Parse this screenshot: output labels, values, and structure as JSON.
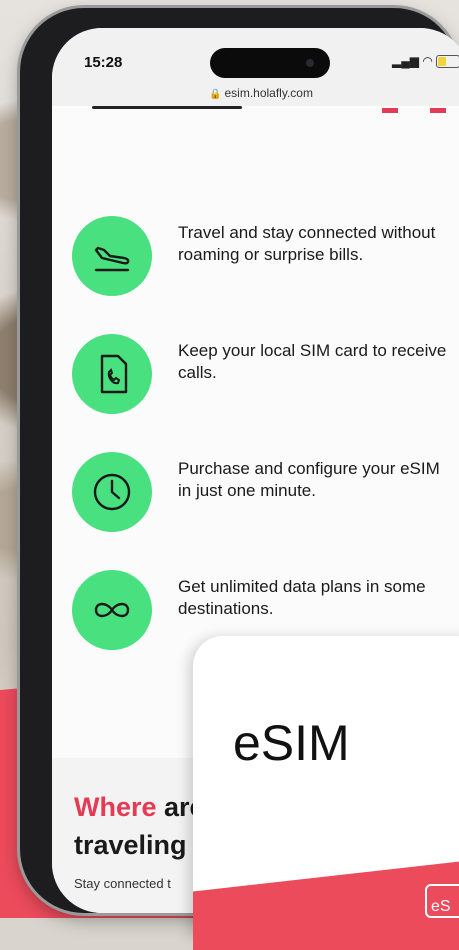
{
  "status_bar": {
    "time": "15:28",
    "url": "esim.holafly.com"
  },
  "features": [
    {
      "icon": "airplane-landing-icon",
      "text": "Travel and stay connected without roaming or surprise bills."
    },
    {
      "icon": "phone-call-icon",
      "text": "Keep your local SIM card to receive calls."
    },
    {
      "icon": "clock-icon",
      "text": "Purchase and configure your eSIM in just one minute."
    },
    {
      "icon": "infinity-icon",
      "text": "Get unlimited data plans in some destinations."
    }
  ],
  "section": {
    "heading_accent": "Where",
    "heading_rest_1": " are",
    "heading_line_2": "traveling t",
    "subtext": "Stay connected t"
  },
  "card": {
    "label": "eSIM",
    "mini_label": "eS"
  },
  "colors": {
    "accent_red": "#e23b53",
    "icon_green": "#49e07f",
    "pink_bg": "#ec4b5c"
  }
}
